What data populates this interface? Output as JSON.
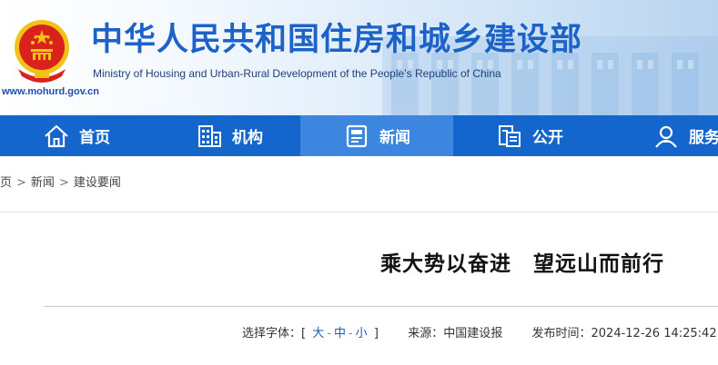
{
  "header": {
    "title": "中华人民共和国住房和城乡建设部",
    "subtitle": "Ministry of Housing and Urban-Rural Development of the People’s Republic of China",
    "url": "www.mohurd.gov.cn",
    "emblem_icon": "national-emblem-icon"
  },
  "nav": {
    "items": [
      {
        "label": "首页",
        "icon": "home-icon"
      },
      {
        "label": "机构",
        "icon": "building-icon"
      },
      {
        "label": "新闻",
        "icon": "newspaper-icon",
        "active": true
      },
      {
        "label": "公开",
        "icon": "document-icon"
      },
      {
        "label": "服务",
        "icon": "user-service-icon"
      }
    ],
    "active_index": 2
  },
  "breadcrumb": {
    "items": [
      "页",
      "新闻",
      "建设要闻"
    ],
    "separator": ">"
  },
  "article": {
    "title_part1": "乘大势以奋进",
    "title_part2": "望远山而前行",
    "font_select_label": "选择字体：",
    "bracket_open": "[",
    "bracket_close": "]",
    "size_large": "大",
    "size_medium": "中",
    "size_small": "小",
    "size_separator": "-",
    "source_label": "来源：",
    "source_value": "中国建设报",
    "time_label": "发布时间：",
    "time_value": "2024-12-26 14:25:42"
  },
  "colors": {
    "nav_bg": "#1466cc",
    "nav_active": "#3d86df",
    "title_blue": "#1d62c6",
    "emblem_red": "#d9221c",
    "emblem_gold": "#f2c316"
  }
}
